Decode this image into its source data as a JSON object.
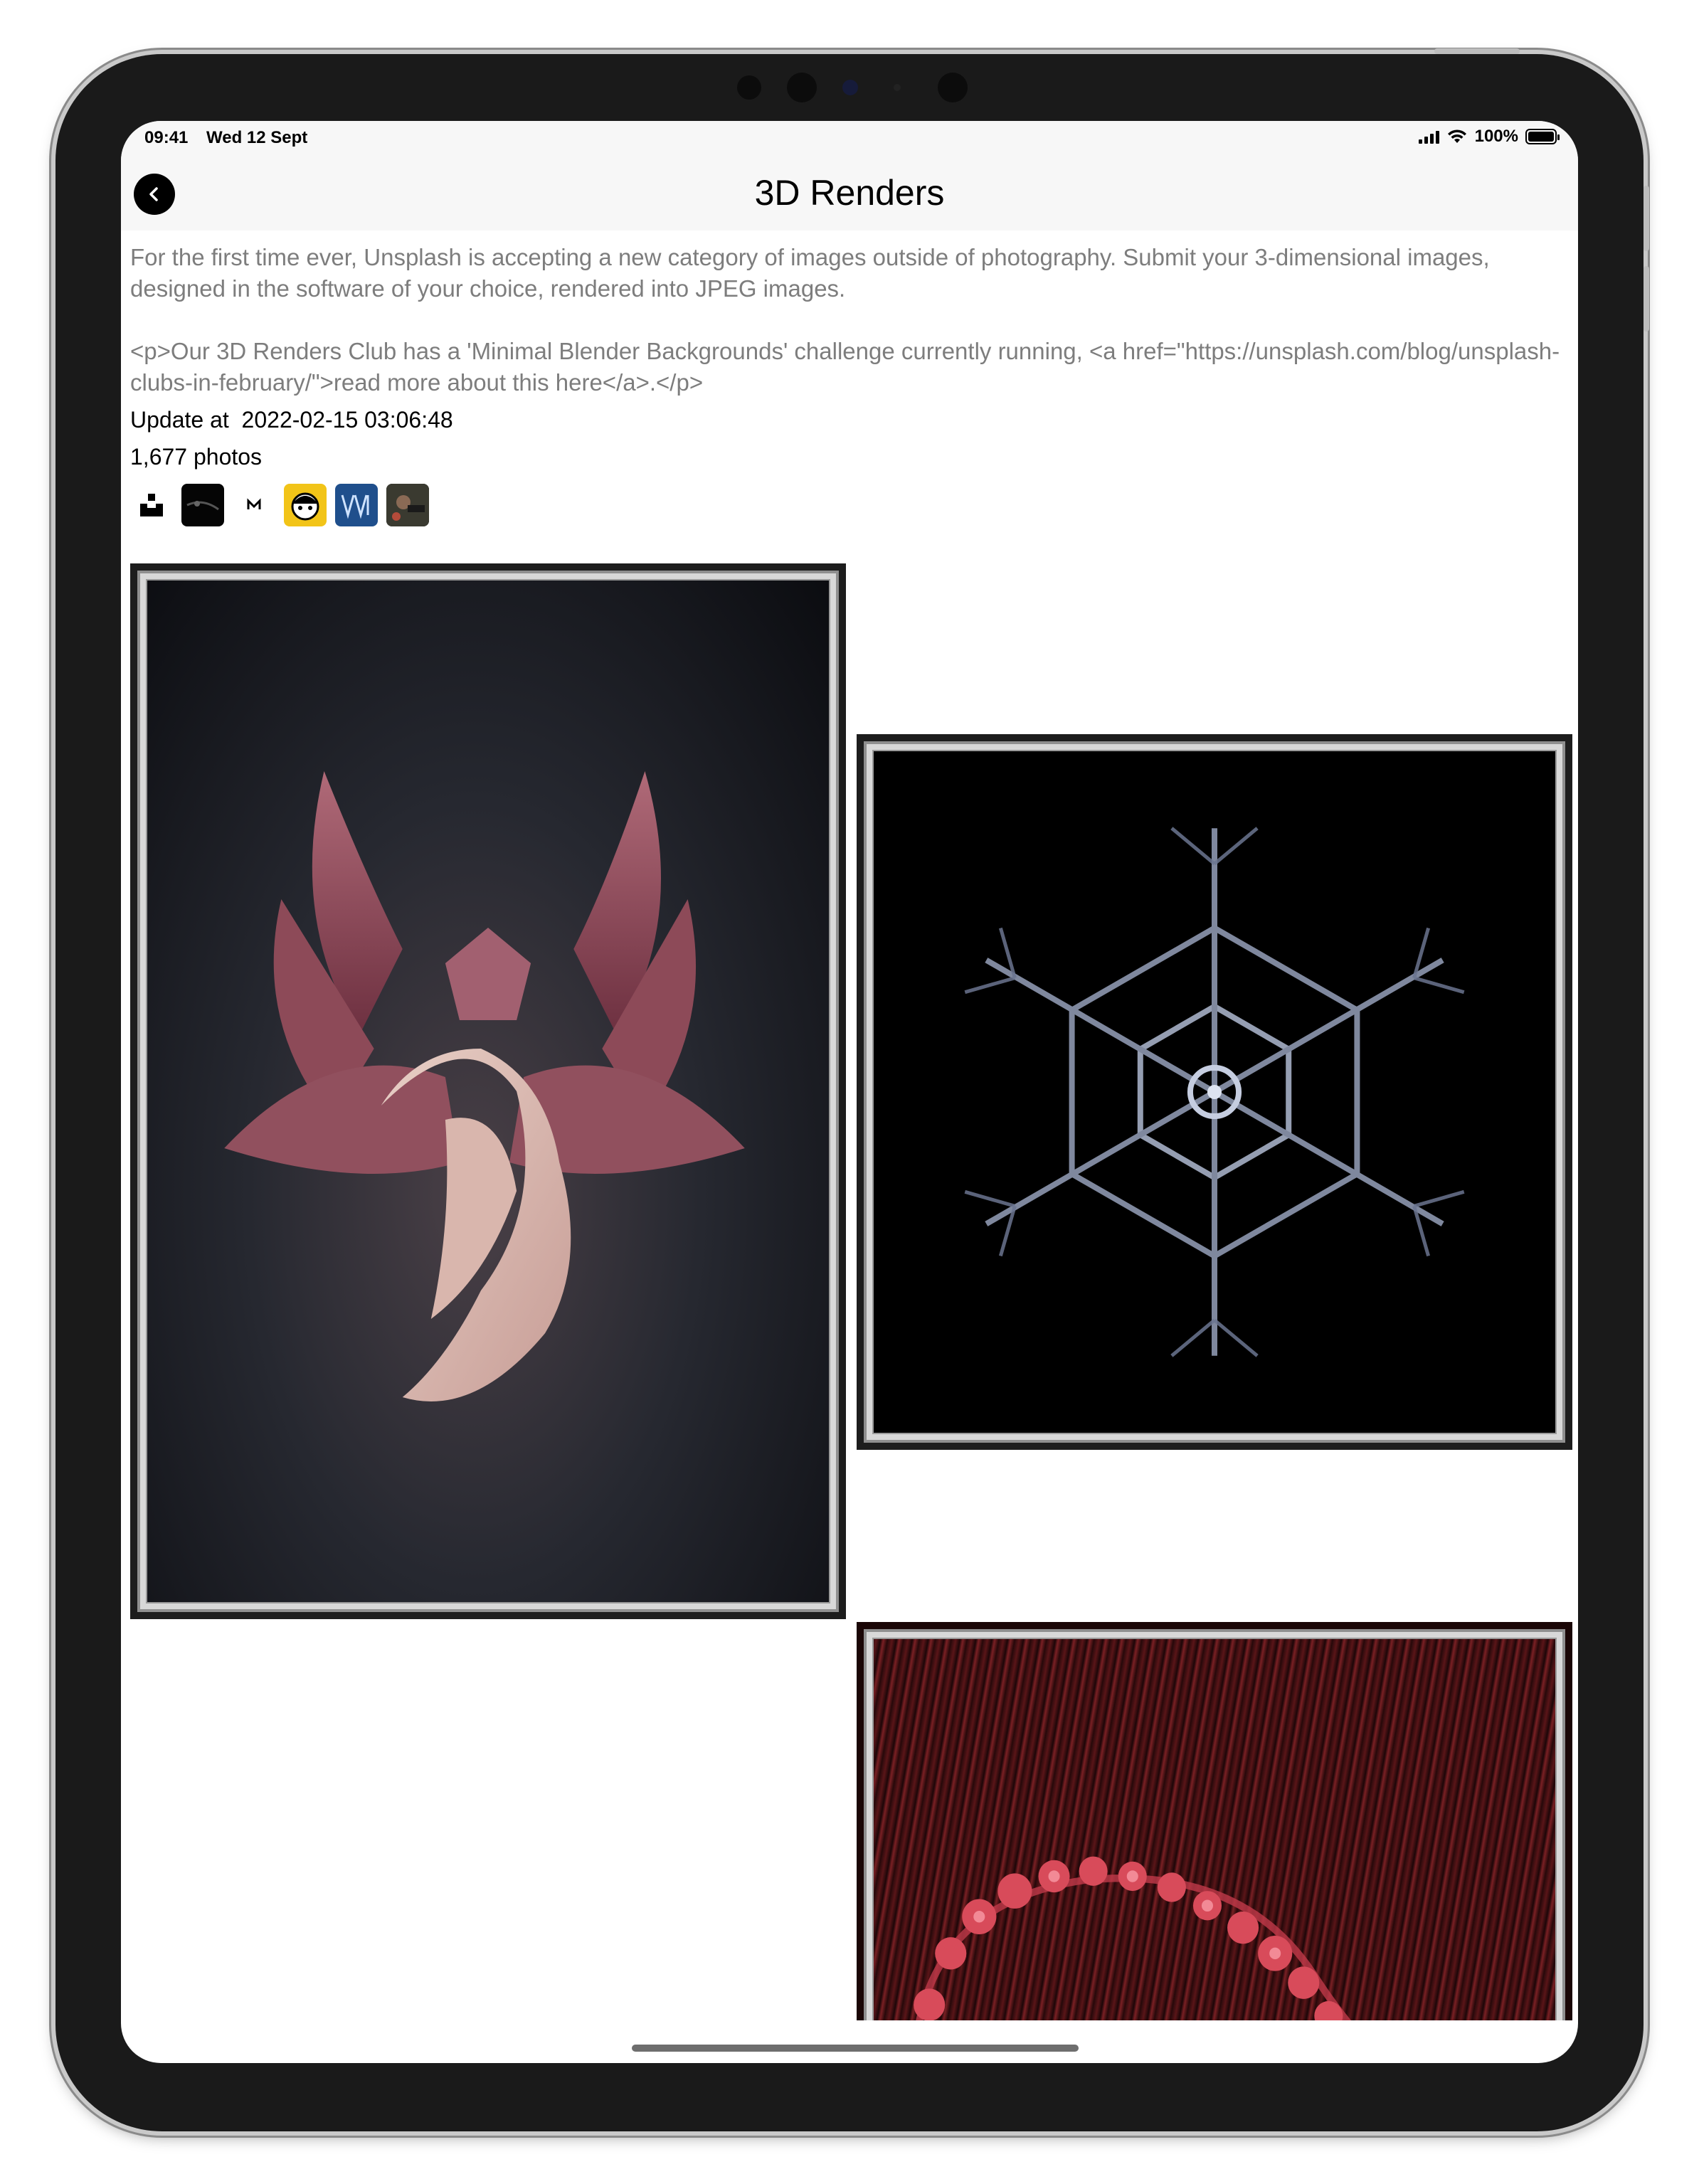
{
  "status_bar": {
    "time": "09:41",
    "date": "Wed 12 Sept",
    "battery": "100%"
  },
  "nav": {
    "title": "3D Renders",
    "back_icon": "chevron-left-icon"
  },
  "collection": {
    "description": "For the first time ever, Unsplash is accepting a new category of images outside of photography. Submit your 3-dimensional images, designed in the software of your choice, rendered into JPEG images.",
    "description_html": "<p>Our 3D Renders Club has a 'Minimal Blender Backgrounds' challenge currently running, <a href=\"https://unsplash.com/blog/unsplash-clubs-in-february/\">read more about this here</a>.</p>",
    "updated_label": "Update at",
    "updated_at": "2022-02-15 03:06:48",
    "photo_count": "1,677 photos",
    "contributors": [
      "unsplash-logo-avatar",
      "dark-avatar",
      "logo-avatar",
      "cartoon-avatar",
      "blue-logo-avatar",
      "photo-avatar"
    ]
  },
  "photos": [
    {
      "name": "pink-abstract-render"
    },
    {
      "name": "crystal-snowflake-render"
    },
    {
      "name": "red-fractal-spiral-render"
    }
  ],
  "colors": {
    "description_text": "#7d7d7d",
    "bar_background": "#f7f7f7"
  }
}
